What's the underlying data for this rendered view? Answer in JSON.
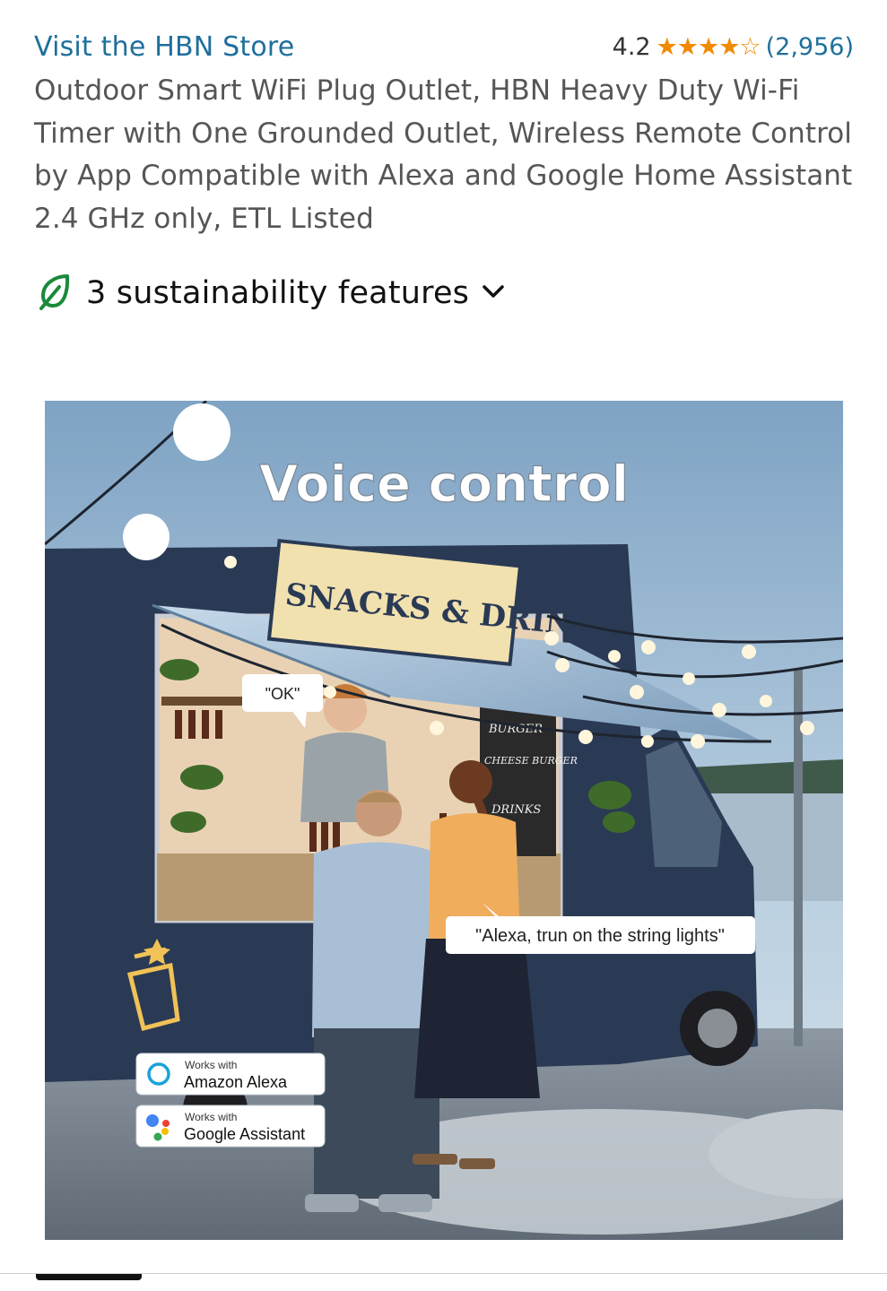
{
  "header": {
    "store_link": "Visit the HBN Store",
    "rating_value": "4.2",
    "stars_filled": 4,
    "stars_total": 5,
    "rating_fraction": 0.84,
    "review_count": "(2,956)"
  },
  "product": {
    "title": "Outdoor Smart WiFi Plug Outlet, HBN Heavy Duty Wi-Fi Timer with One Grounded Outlet, Wireless Remote Control by App Compatible with Alexa and Google Home Assistant 2.4 GHz only, ETL Listed"
  },
  "sustainability": {
    "label": "3 sustainability features",
    "icon": "leaf-icon",
    "chevron": "chevron-down-icon",
    "accent": "#1a8a3a"
  },
  "image": {
    "heading": "Voice control",
    "sign": "SNACKS & DRINKS",
    "menu_text": "BURGER · CHEESE BURGER · DRINKS",
    "bubble_ok": "\"OK\"",
    "bubble_alexa": "\"Alexa, trun on the string lights\"",
    "badges": [
      {
        "small": "Works with",
        "big": "Amazon Alexa",
        "icon": "alexa-ring-icon"
      },
      {
        "small": "Works with",
        "big": "Google Assistant",
        "icon": "google-assistant-icon"
      }
    ]
  },
  "colors": {
    "link": "#1f6f9c",
    "star": "#f08a00",
    "title_text": "#565656"
  }
}
